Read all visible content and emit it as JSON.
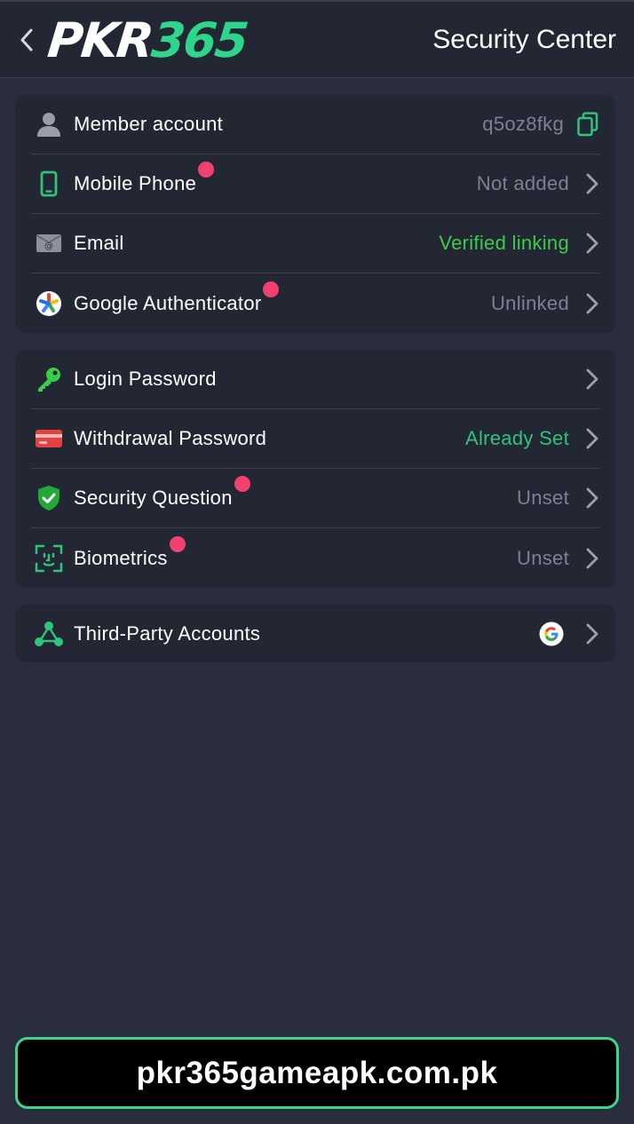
{
  "header": {
    "logo_white": "PKR",
    "logo_green": "365",
    "title": "Security Center"
  },
  "account_section": {
    "items": [
      {
        "label": "Member account",
        "value": "q5oz8fkg",
        "icon": "user-icon",
        "action_icon": "copy-icon"
      },
      {
        "label": "Mobile Phone",
        "value": "Not added",
        "icon": "phone-icon",
        "badge": true
      },
      {
        "label": "Email",
        "value": "Verified linking",
        "icon": "email-icon",
        "value_color": "#3bcc4c"
      },
      {
        "label": "Google Authenticator",
        "value": "Unlinked",
        "icon": "google-authenticator-icon",
        "badge": true
      }
    ]
  },
  "password_section": {
    "items": [
      {
        "label": "Login Password",
        "value": "",
        "icon": "key-icon"
      },
      {
        "label": "Withdrawal Password",
        "value": "Already Set",
        "icon": "card-icon",
        "value_color": "#2fc47a"
      },
      {
        "label": "Security Question",
        "value": "Unset",
        "icon": "shield-check-icon",
        "badge": true
      },
      {
        "label": "Biometrics",
        "value": "Unset",
        "icon": "face-scan-icon",
        "badge": true
      }
    ]
  },
  "third_party_section": {
    "items": [
      {
        "label": "Third-Party Accounts",
        "icon": "network-icon",
        "linked_icon": "google-icon"
      }
    ]
  },
  "footer": {
    "text": "pkr365gameapk.com.pk"
  },
  "colors": {
    "background": "#2a2d3c",
    "card": "#232633",
    "accent_green": "#2fd58a",
    "badge_red": "#f2416e",
    "muted_text": "#7d8190"
  }
}
